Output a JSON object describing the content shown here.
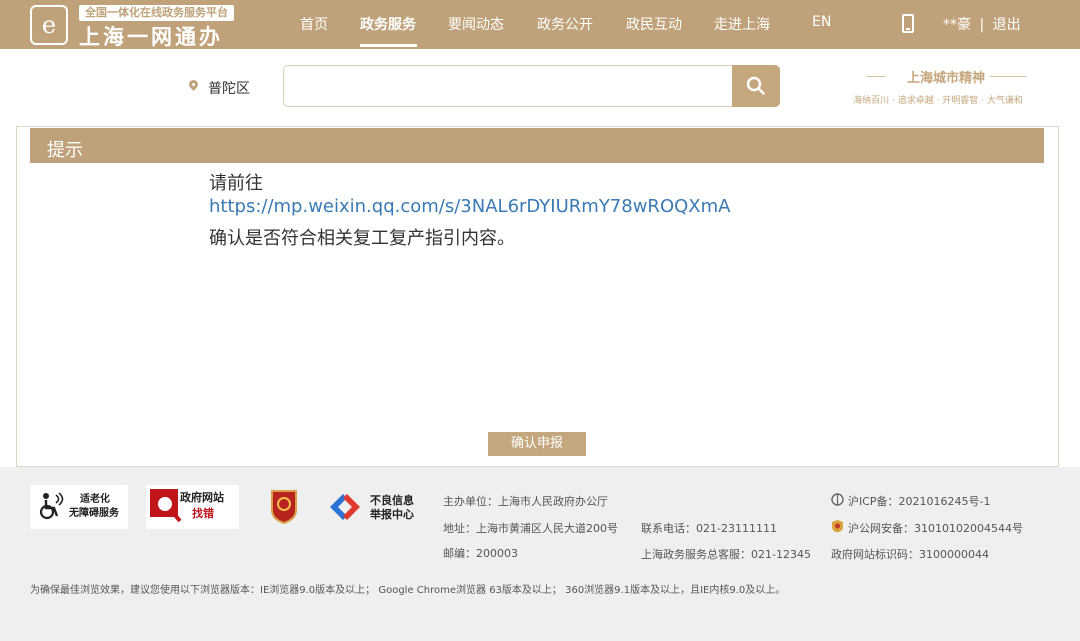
{
  "header": {
    "logo_glyph": "e",
    "logo_tagline": "全国一体化在线政务服务平台",
    "logo_name": "上海一网通办",
    "nav": [
      {
        "label": "首页"
      },
      {
        "label": "政务服务",
        "active": true
      },
      {
        "label": "要闻动态"
      },
      {
        "label": "政务公开"
      },
      {
        "label": "政民互动"
      },
      {
        "label": "走进上海"
      },
      {
        "label": "EN"
      }
    ],
    "mobile_icon": "phone-icon",
    "user": "**豪",
    "separator": "|",
    "logout": "退出"
  },
  "search": {
    "location_icon": "map-pin-icon",
    "district": "普陀区",
    "placeholder": "",
    "value": "",
    "button_icon": "search-icon"
  },
  "spirit": {
    "title": "上海城市精神",
    "subtitle": "海纳百川 · 追求卓越 · 开明睿智 · 大气谦和"
  },
  "dialog": {
    "title": "提示",
    "line1": "请前往",
    "link": "https://mp.weixin.qq.com/s/3NAL6rDYIURmY78wROQXmA",
    "line3": "确认是否符合相关复工复产指引内容。",
    "confirm": "确认申报"
  },
  "footer": {
    "badges": {
      "accessibility_line1": "适老化",
      "accessibility_line2": "无障碍服务",
      "gov_site_line1": "政府网站",
      "gov_site_line2": "找错",
      "report_line1": "不良信息",
      "report_line2": "举报中心"
    },
    "sponsor": "主办单位：上海市人民政府办公厅",
    "address": "地址：上海市黄浦区人民大道200号",
    "postcode": "邮编：200003",
    "phone": "联系电话：021-23111111",
    "hotline": "上海政务服务总客服：021-12345",
    "icp": "沪ICP备：2021016245号-1",
    "police": "沪公网安备：31010102004544号",
    "site_id": "政府网站标识码：3100000044",
    "browser_note": "为确保最佳浏览效果，建议您使用以下浏览器版本：IE浏览器9.0版本及以上； Google Chrome浏览器 63版本及以上； 360浏览器9.1版本及以上，且IE内核9.0及以上。"
  },
  "colors": {
    "brand": "#bfa27a",
    "link": "#3a7ab5"
  }
}
